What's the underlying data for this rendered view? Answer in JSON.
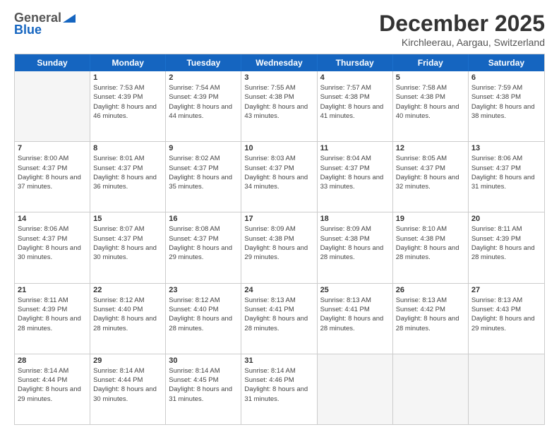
{
  "header": {
    "logo_general": "General",
    "logo_blue": "Blue",
    "title": "December 2025",
    "subtitle": "Kirchleerau, Aargau, Switzerland"
  },
  "weekdays": [
    "Sunday",
    "Monday",
    "Tuesday",
    "Wednesday",
    "Thursday",
    "Friday",
    "Saturday"
  ],
  "weeks": [
    [
      {
        "day": "",
        "empty": true
      },
      {
        "day": "1",
        "sunrise": "7:53 AM",
        "sunset": "4:39 PM",
        "daylight": "8 hours and 46 minutes."
      },
      {
        "day": "2",
        "sunrise": "7:54 AM",
        "sunset": "4:39 PM",
        "daylight": "8 hours and 44 minutes."
      },
      {
        "day": "3",
        "sunrise": "7:55 AM",
        "sunset": "4:38 PM",
        "daylight": "8 hours and 43 minutes."
      },
      {
        "day": "4",
        "sunrise": "7:57 AM",
        "sunset": "4:38 PM",
        "daylight": "8 hours and 41 minutes."
      },
      {
        "day": "5",
        "sunrise": "7:58 AM",
        "sunset": "4:38 PM",
        "daylight": "8 hours and 40 minutes."
      },
      {
        "day": "6",
        "sunrise": "7:59 AM",
        "sunset": "4:38 PM",
        "daylight": "8 hours and 38 minutes."
      }
    ],
    [
      {
        "day": "7",
        "sunrise": "8:00 AM",
        "sunset": "4:37 PM",
        "daylight": "8 hours and 37 minutes."
      },
      {
        "day": "8",
        "sunrise": "8:01 AM",
        "sunset": "4:37 PM",
        "daylight": "8 hours and 36 minutes."
      },
      {
        "day": "9",
        "sunrise": "8:02 AM",
        "sunset": "4:37 PM",
        "daylight": "8 hours and 35 minutes."
      },
      {
        "day": "10",
        "sunrise": "8:03 AM",
        "sunset": "4:37 PM",
        "daylight": "8 hours and 34 minutes."
      },
      {
        "day": "11",
        "sunrise": "8:04 AM",
        "sunset": "4:37 PM",
        "daylight": "8 hours and 33 minutes."
      },
      {
        "day": "12",
        "sunrise": "8:05 AM",
        "sunset": "4:37 PM",
        "daylight": "8 hours and 32 minutes."
      },
      {
        "day": "13",
        "sunrise": "8:06 AM",
        "sunset": "4:37 PM",
        "daylight": "8 hours and 31 minutes."
      }
    ],
    [
      {
        "day": "14",
        "sunrise": "8:06 AM",
        "sunset": "4:37 PM",
        "daylight": "8 hours and 30 minutes."
      },
      {
        "day": "15",
        "sunrise": "8:07 AM",
        "sunset": "4:37 PM",
        "daylight": "8 hours and 30 minutes."
      },
      {
        "day": "16",
        "sunrise": "8:08 AM",
        "sunset": "4:37 PM",
        "daylight": "8 hours and 29 minutes."
      },
      {
        "day": "17",
        "sunrise": "8:09 AM",
        "sunset": "4:38 PM",
        "daylight": "8 hours and 29 minutes."
      },
      {
        "day": "18",
        "sunrise": "8:09 AM",
        "sunset": "4:38 PM",
        "daylight": "8 hours and 28 minutes."
      },
      {
        "day": "19",
        "sunrise": "8:10 AM",
        "sunset": "4:38 PM",
        "daylight": "8 hours and 28 minutes."
      },
      {
        "day": "20",
        "sunrise": "8:11 AM",
        "sunset": "4:39 PM",
        "daylight": "8 hours and 28 minutes."
      }
    ],
    [
      {
        "day": "21",
        "sunrise": "8:11 AM",
        "sunset": "4:39 PM",
        "daylight": "8 hours and 28 minutes."
      },
      {
        "day": "22",
        "sunrise": "8:12 AM",
        "sunset": "4:40 PM",
        "daylight": "8 hours and 28 minutes."
      },
      {
        "day": "23",
        "sunrise": "8:12 AM",
        "sunset": "4:40 PM",
        "daylight": "8 hours and 28 minutes."
      },
      {
        "day": "24",
        "sunrise": "8:13 AM",
        "sunset": "4:41 PM",
        "daylight": "8 hours and 28 minutes."
      },
      {
        "day": "25",
        "sunrise": "8:13 AM",
        "sunset": "4:41 PM",
        "daylight": "8 hours and 28 minutes."
      },
      {
        "day": "26",
        "sunrise": "8:13 AM",
        "sunset": "4:42 PM",
        "daylight": "8 hours and 28 minutes."
      },
      {
        "day": "27",
        "sunrise": "8:13 AM",
        "sunset": "4:43 PM",
        "daylight": "8 hours and 29 minutes."
      }
    ],
    [
      {
        "day": "28",
        "sunrise": "8:14 AM",
        "sunset": "4:44 PM",
        "daylight": "8 hours and 29 minutes."
      },
      {
        "day": "29",
        "sunrise": "8:14 AM",
        "sunset": "4:44 PM",
        "daylight": "8 hours and 30 minutes."
      },
      {
        "day": "30",
        "sunrise": "8:14 AM",
        "sunset": "4:45 PM",
        "daylight": "8 hours and 31 minutes."
      },
      {
        "day": "31",
        "sunrise": "8:14 AM",
        "sunset": "4:46 PM",
        "daylight": "8 hours and 31 minutes."
      },
      {
        "day": "",
        "empty": true
      },
      {
        "day": "",
        "empty": true
      },
      {
        "day": "",
        "empty": true
      }
    ]
  ]
}
